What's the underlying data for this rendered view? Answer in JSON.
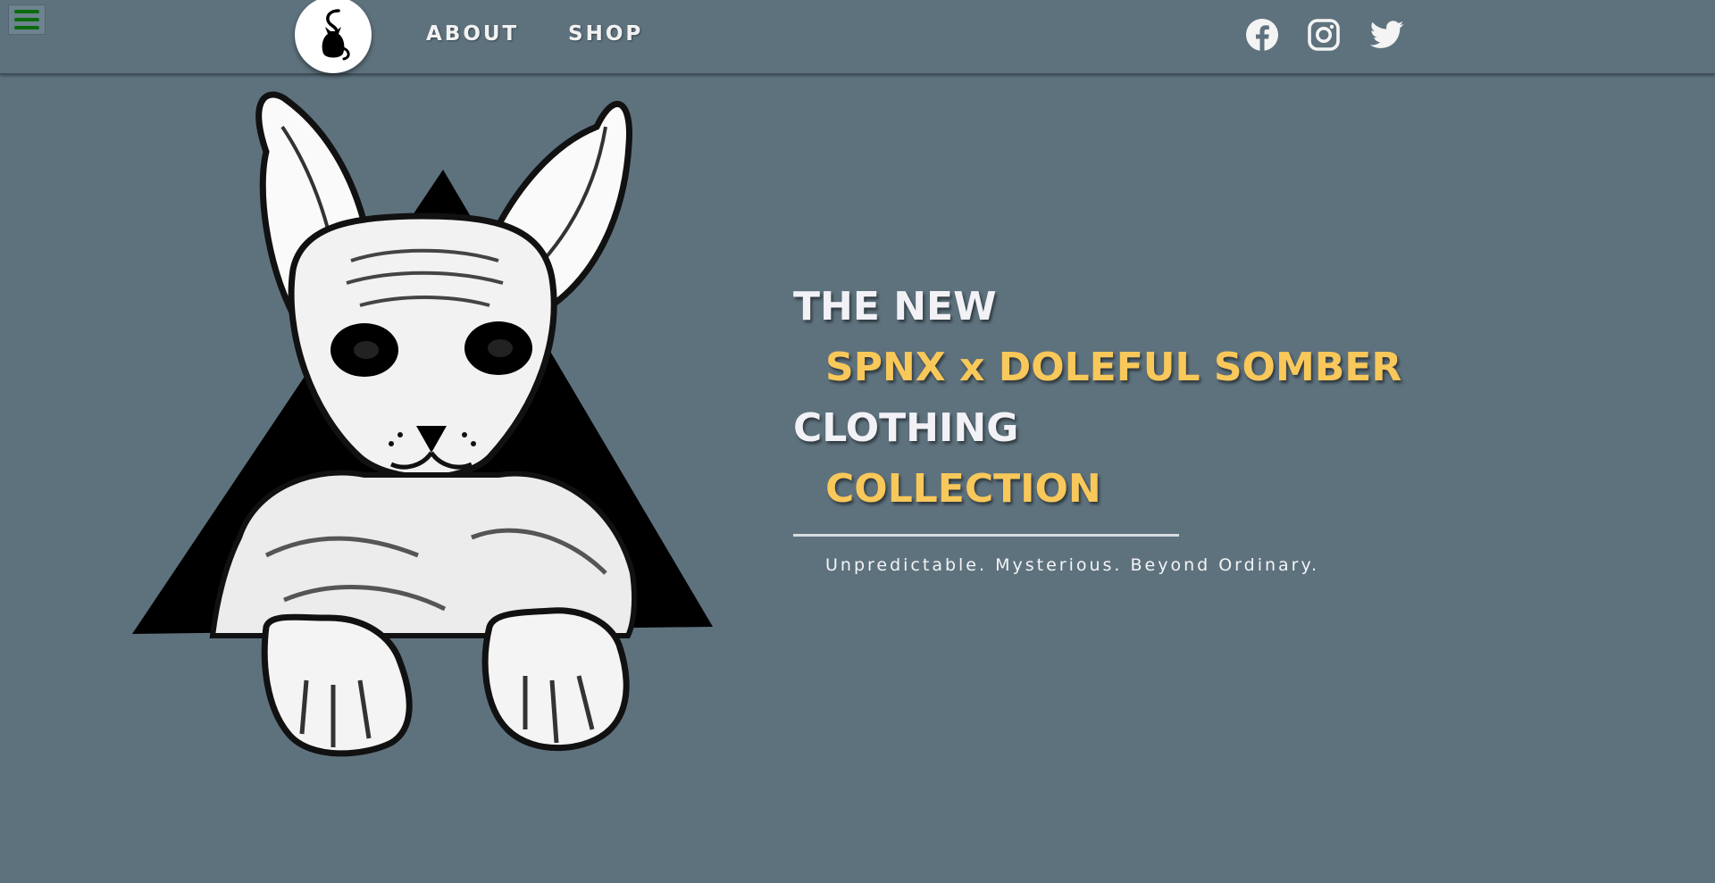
{
  "header": {
    "menu_icon": "hamburger-menu-icon",
    "logo_icon": "sphynx-cat-logo-icon",
    "nav": {
      "about_label": "ABOUT",
      "shop_label": "SHOP"
    },
    "social": [
      {
        "name": "facebook",
        "icon": "facebook-icon"
      },
      {
        "name": "instagram",
        "icon": "instagram-icon"
      },
      {
        "name": "twitter",
        "icon": "twitter-icon"
      }
    ]
  },
  "hero": {
    "art_icon": "sphynx-cat-triangle-illustration",
    "headline": {
      "line1": "THE NEW",
      "line2": "SPNX x DOLEFUL SOMBER",
      "line3": "CLOTHING",
      "line4": "COLLECTION"
    },
    "tagline": "Unpredictable. Mysterious. Beyond Ordinary."
  },
  "colors": {
    "background": "#5e727e",
    "accent_gold": "#f9c85a",
    "headline_white": "#f1f1f6",
    "menu_green": "#0b6b0b"
  }
}
